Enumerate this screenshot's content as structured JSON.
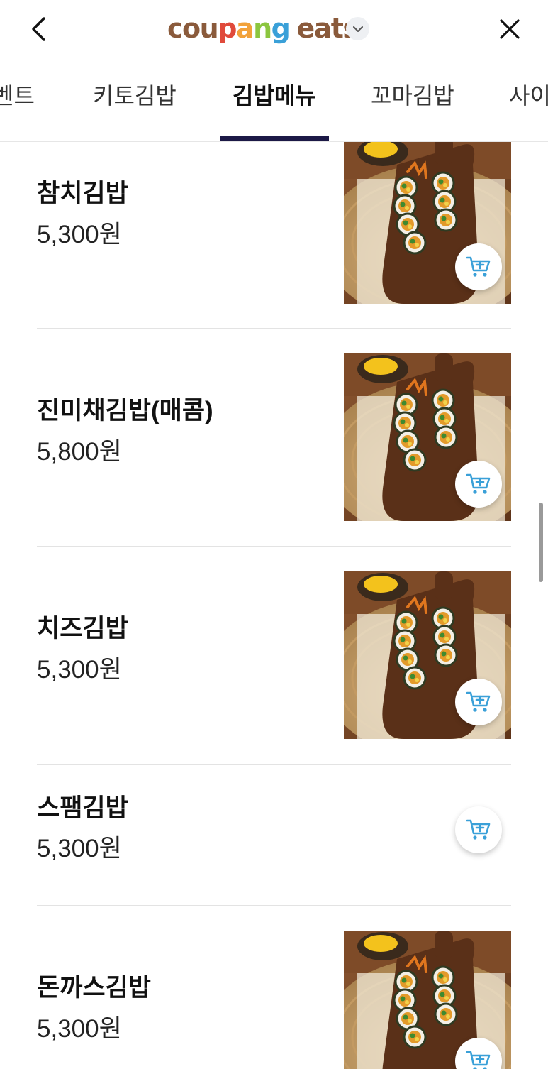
{
  "header": {
    "back_icon": "chevron-left-icon",
    "close_icon": "close-icon",
    "dropdown_icon": "chevron-down-icon",
    "logo": {
      "letters": [
        {
          "ch": "c",
          "color": "#8a5a3b"
        },
        {
          "ch": "o",
          "color": "#8a5a3b"
        },
        {
          "ch": "u",
          "color": "#8a5a3b"
        },
        {
          "ch": "p",
          "color": "#e04a3b"
        },
        {
          "ch": "a",
          "color": "#f2a23a"
        },
        {
          "ch": "n",
          "color": "#8cc63f"
        },
        {
          "ch": "g",
          "color": "#3aa0d8"
        }
      ],
      "eats": "eats",
      "eats_color": "#8a5a3b"
    }
  },
  "tabs": [
    {
      "label": "벤트",
      "active": false
    },
    {
      "label": "키토김밥",
      "active": false
    },
    {
      "label": "김밥메뉴",
      "active": true
    },
    {
      "label": "꼬마김밥",
      "active": false
    },
    {
      "label": "사이",
      "active": false
    }
  ],
  "menu_items": [
    {
      "name": "참치김밥",
      "price": "5,300원",
      "has_image": true
    },
    {
      "name": "진미채김밥(매콤)",
      "price": "5,800원",
      "has_image": true
    },
    {
      "name": "치즈김밥",
      "price": "5,300원",
      "has_image": true
    },
    {
      "name": "스팸김밥",
      "price": "5,300원",
      "has_image": false
    },
    {
      "name": "돈까스김밥",
      "price": "5,300원",
      "has_image": true
    }
  ],
  "cart_icon": "add-to-cart-icon",
  "colors": {
    "accent_underline": "#1c1946",
    "cart_icon": "#3aa0d8",
    "divider": "#e3e3e3"
  }
}
